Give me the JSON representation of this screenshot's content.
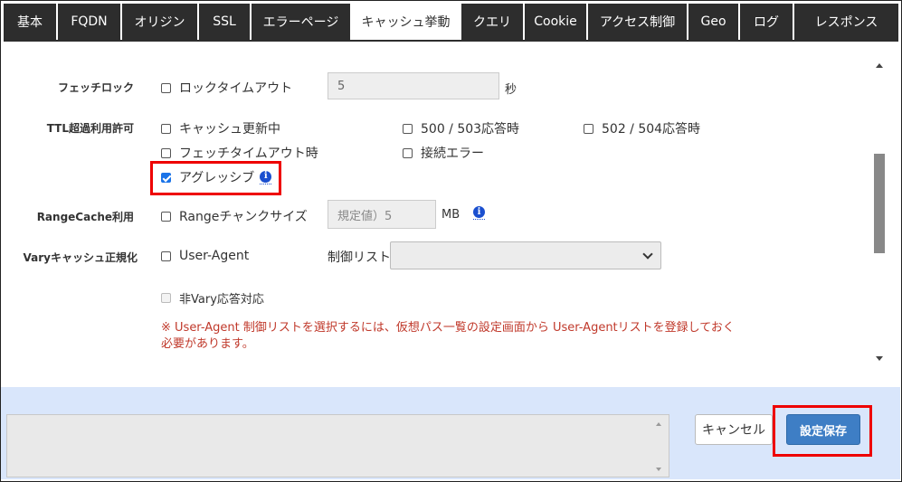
{
  "tabs": [
    {
      "label": "基本"
    },
    {
      "label": "FQDN"
    },
    {
      "label": "オリジン"
    },
    {
      "label": "SSL"
    },
    {
      "label": "エラーページ"
    },
    {
      "label": "キャッシュ挙動"
    },
    {
      "label": "クエリ"
    },
    {
      "label": "Cookie"
    },
    {
      "label": "アクセス制御"
    },
    {
      "label": "Geo"
    },
    {
      "label": "ログ"
    },
    {
      "label": "レスポンス"
    }
  ],
  "active_tab": "キャッシュ挙動",
  "fetch_lock": {
    "label": "フェッチロック",
    "option": "ロックタイムアウト",
    "value": "5",
    "unit": "秒"
  },
  "ttl_overuse": {
    "label": "TTL超過利用許可",
    "options": [
      {
        "label": "キャッシュ更新中",
        "checked": false
      },
      {
        "label": "500 / 503応答時",
        "checked": false
      },
      {
        "label": "502 / 504応答時",
        "checked": false
      },
      {
        "label": "フェッチタイムアウト時",
        "checked": false
      },
      {
        "label": "接続エラー",
        "checked": false
      },
      {
        "label": "アグレッシブ",
        "checked": true
      }
    ]
  },
  "range_cache": {
    "label": "RangeCache利用",
    "option": "Rangeチャンクサイズ",
    "placeholder": "規定値）5",
    "unit": "MB"
  },
  "vary_cache": {
    "label": "Varyキャッシュ正規化",
    "option": "User-Agent",
    "control_list_label": "制御リスト",
    "control_list_value": "",
    "non_vary_option": "非Vary応答対応",
    "note": "※ User-Agent 制御リストを選択するには、仮想パス一覧の設定画面から User-Agentリストを登録しておく必要があります。"
  },
  "footer": {
    "cancel_label": "キャンセル",
    "save_label": "設定保存"
  },
  "colors": {
    "tab_bg": "#2d2d2d",
    "highlight": "#ee0000",
    "save_button": "#3e7ec5",
    "footer_bg": "#d9e6fb",
    "note_text": "#c0392b"
  }
}
